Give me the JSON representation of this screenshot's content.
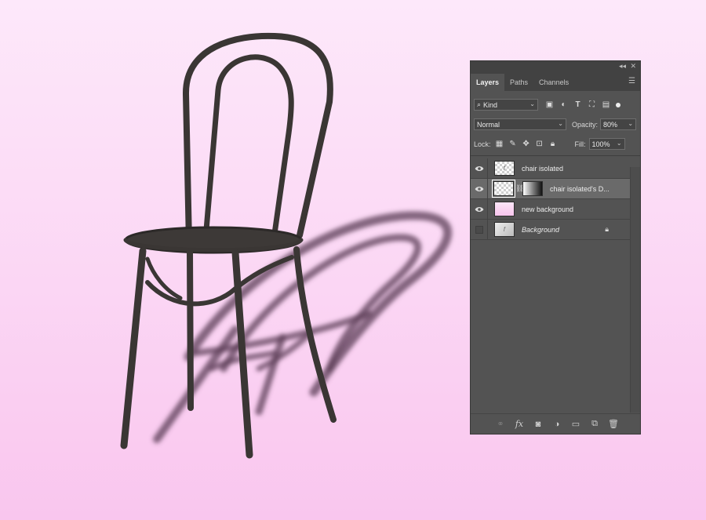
{
  "colors": {
    "canvas_top": "#fde8fa",
    "canvas_bottom": "#f9c6ee",
    "panel_bg": "#535353",
    "panel_header": "#424242",
    "selected_row": "#6a6a6a",
    "chair": "#3a3634",
    "shadow": "#5a3d55"
  },
  "panel": {
    "collapse_icon": "double-chevron-right-icon",
    "close_icon": "close-icon",
    "tabs": [
      {
        "label": "Layers",
        "active": true
      },
      {
        "label": "Paths",
        "active": false
      },
      {
        "label": "Channels",
        "active": false
      }
    ],
    "filter": {
      "kind_label": "Kind",
      "icons": [
        "pixel-filter-icon",
        "adjustment-filter-icon",
        "type-filter-icon",
        "shape-filter-icon",
        "smart-object-filter-icon"
      ]
    },
    "blend_mode": "Normal",
    "opacity_label": "Opacity:",
    "opacity_value": "80%",
    "lock_label": "Lock:",
    "lock_icons": [
      "lock-transparent-icon",
      "lock-pixels-icon",
      "lock-position-icon",
      "artboard-nesting-icon",
      "lock-all-icon"
    ],
    "fill_label": "Fill:",
    "fill_value": "100%",
    "layers": [
      {
        "name": "chair isolated",
        "visible": true,
        "selected": false,
        "thumb": "checker-chair"
      },
      {
        "name": "chair isolated's D...",
        "visible": true,
        "selected": true,
        "thumb": "checker-with-mask"
      },
      {
        "name": "new background",
        "visible": true,
        "selected": false,
        "thumb": "pink"
      },
      {
        "name": "Background",
        "visible": false,
        "selected": false,
        "thumb": "photo",
        "locked": true
      }
    ],
    "footer_icons": [
      "link-layers-icon",
      "fx-icon",
      "add-mask-icon",
      "adjustment-layer-icon",
      "folder-icon",
      "new-layer-icon",
      "trash-icon"
    ],
    "fx_label": "fx"
  }
}
